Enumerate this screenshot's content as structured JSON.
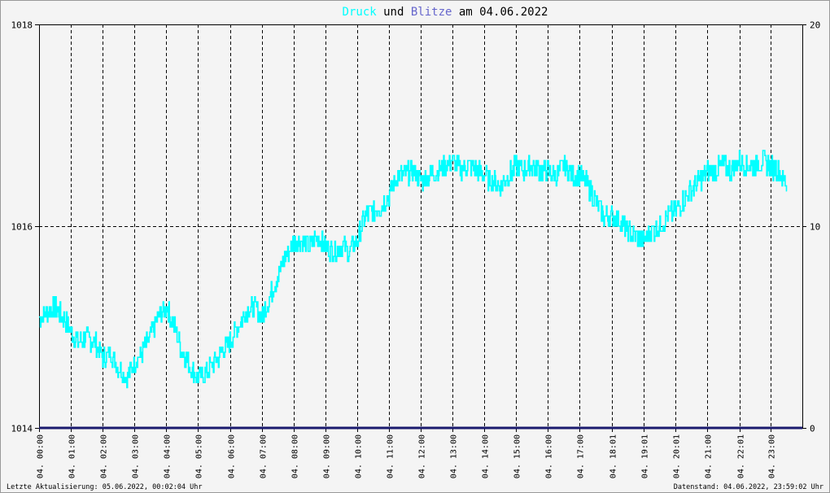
{
  "title": {
    "part1": "Druck",
    "part2": " und ",
    "part3": "Blitze",
    "part4": " am 04.06.2022"
  },
  "colors": {
    "pressure": "#00ffff",
    "lightning": "#6666cc",
    "axis": "#000000",
    "baseline": "#1a1a6e",
    "title_text": "#000000"
  },
  "footer": {
    "left": "Letzte Aktualisierung: 05.06.2022, 00:02:04 Uhr",
    "right": "Datenstand: 04.06.2022, 23:59:02 Uhr"
  },
  "chart_data": {
    "type": "line",
    "x_ticks": [
      "04. 00:00",
      "04. 01:00",
      "04. 02:00",
      "04. 03:00",
      "04. 04:00",
      "04. 05:00",
      "04. 06:00",
      "04. 07:00",
      "04. 08:00",
      "04. 09:00",
      "04. 10:00",
      "04. 11:00",
      "04. 12:00",
      "04. 13:00",
      "04. 14:00",
      "04. 15:00",
      "04. 16:00",
      "04. 17:00",
      "04. 18:01",
      "04. 19:01",
      "04. 20:01",
      "04. 21:00",
      "04. 22:01",
      "04. 23:00"
    ],
    "x_tick_hours": [
      0,
      1,
      2,
      3,
      4,
      5,
      6,
      7,
      8,
      9,
      10,
      11,
      12,
      13,
      14,
      15,
      16,
      17,
      18.02,
      19.02,
      20.02,
      21,
      22.02,
      23
    ],
    "xlim": [
      0,
      24
    ],
    "y_left_ticks": [
      "1018",
      "1016",
      "1014"
    ],
    "y_left_tick_values": [
      1018,
      1016,
      1014
    ],
    "ylim_left": [
      1014,
      1018
    ],
    "y_right_ticks": [
      "20",
      "10",
      "0"
    ],
    "y_right_tick_values": [
      20,
      10,
      0
    ],
    "ylim_right": [
      0,
      20
    ],
    "grid": true,
    "series": [
      {
        "name": "Druck",
        "axis": "left",
        "x_hours": [
          0,
          0.25,
          0.5,
          0.75,
          1,
          1.25,
          1.5,
          1.75,
          2,
          2.25,
          2.5,
          2.75,
          3,
          3.25,
          3.5,
          3.75,
          4,
          4.25,
          4.5,
          4.75,
          5,
          5.25,
          5.5,
          5.75,
          6,
          6.25,
          6.5,
          6.75,
          7,
          7.25,
          7.5,
          7.75,
          8,
          8.25,
          8.5,
          8.75,
          9,
          9.25,
          9.5,
          9.75,
          10,
          10.25,
          10.5,
          10.75,
          11,
          11.25,
          11.5,
          11.75,
          12,
          12.25,
          12.5,
          12.75,
          13,
          13.25,
          13.5,
          13.75,
          14,
          14.25,
          14.5,
          14.75,
          15,
          15.25,
          15.5,
          15.75,
          16,
          16.25,
          16.5,
          16.75,
          17,
          17.25,
          17.5,
          17.75,
          18,
          18.25,
          18.5,
          18.75,
          19,
          19.25,
          19.5,
          19.75,
          20,
          20.25,
          20.5,
          20.75,
          21,
          21.25,
          21.5,
          21.75,
          22,
          22.25,
          22.5,
          22.75,
          23,
          23.25,
          23.5,
          23.75,
          24
        ],
        "values": [
          1015.1,
          1015.15,
          1015.2,
          1015.1,
          1014.95,
          1014.85,
          1014.9,
          1014.85,
          1014.7,
          1014.75,
          1014.6,
          1014.5,
          1014.65,
          1014.75,
          1014.9,
          1015.1,
          1015.2,
          1015.0,
          1014.75,
          1014.6,
          1014.5,
          1014.55,
          1014.65,
          1014.75,
          1014.85,
          1015.0,
          1015.15,
          1015.2,
          1015.1,
          1015.3,
          1015.5,
          1015.7,
          1015.85,
          1015.85,
          1015.8,
          1015.9,
          1015.8,
          1015.75,
          1015.8,
          1015.75,
          1015.85,
          1016.1,
          1016.15,
          1016.2,
          1016.3,
          1016.5,
          1016.5,
          1016.55,
          1016.45,
          1016.5,
          1016.55,
          1016.6,
          1016.65,
          1016.55,
          1016.6,
          1016.55,
          1016.5,
          1016.45,
          1016.4,
          1016.5,
          1016.6,
          1016.55,
          1016.6,
          1016.55,
          1016.55,
          1016.5,
          1016.6,
          1016.5,
          1016.5,
          1016.4,
          1016.25,
          1016.1,
          1016.1,
          1016.05,
          1015.95,
          1015.9,
          1015.85,
          1015.95,
          1016.0,
          1016.1,
          1016.15,
          1016.25,
          1016.35,
          1016.45,
          1016.55,
          1016.55,
          1016.6,
          1016.55,
          1016.65,
          1016.6,
          1016.6,
          1016.65,
          1016.6,
          1016.55,
          1016.4
        ]
      },
      {
        "name": "Blitze",
        "axis": "right",
        "x_hours": [
          0,
          24
        ],
        "values": [
          0,
          0
        ]
      }
    ]
  }
}
